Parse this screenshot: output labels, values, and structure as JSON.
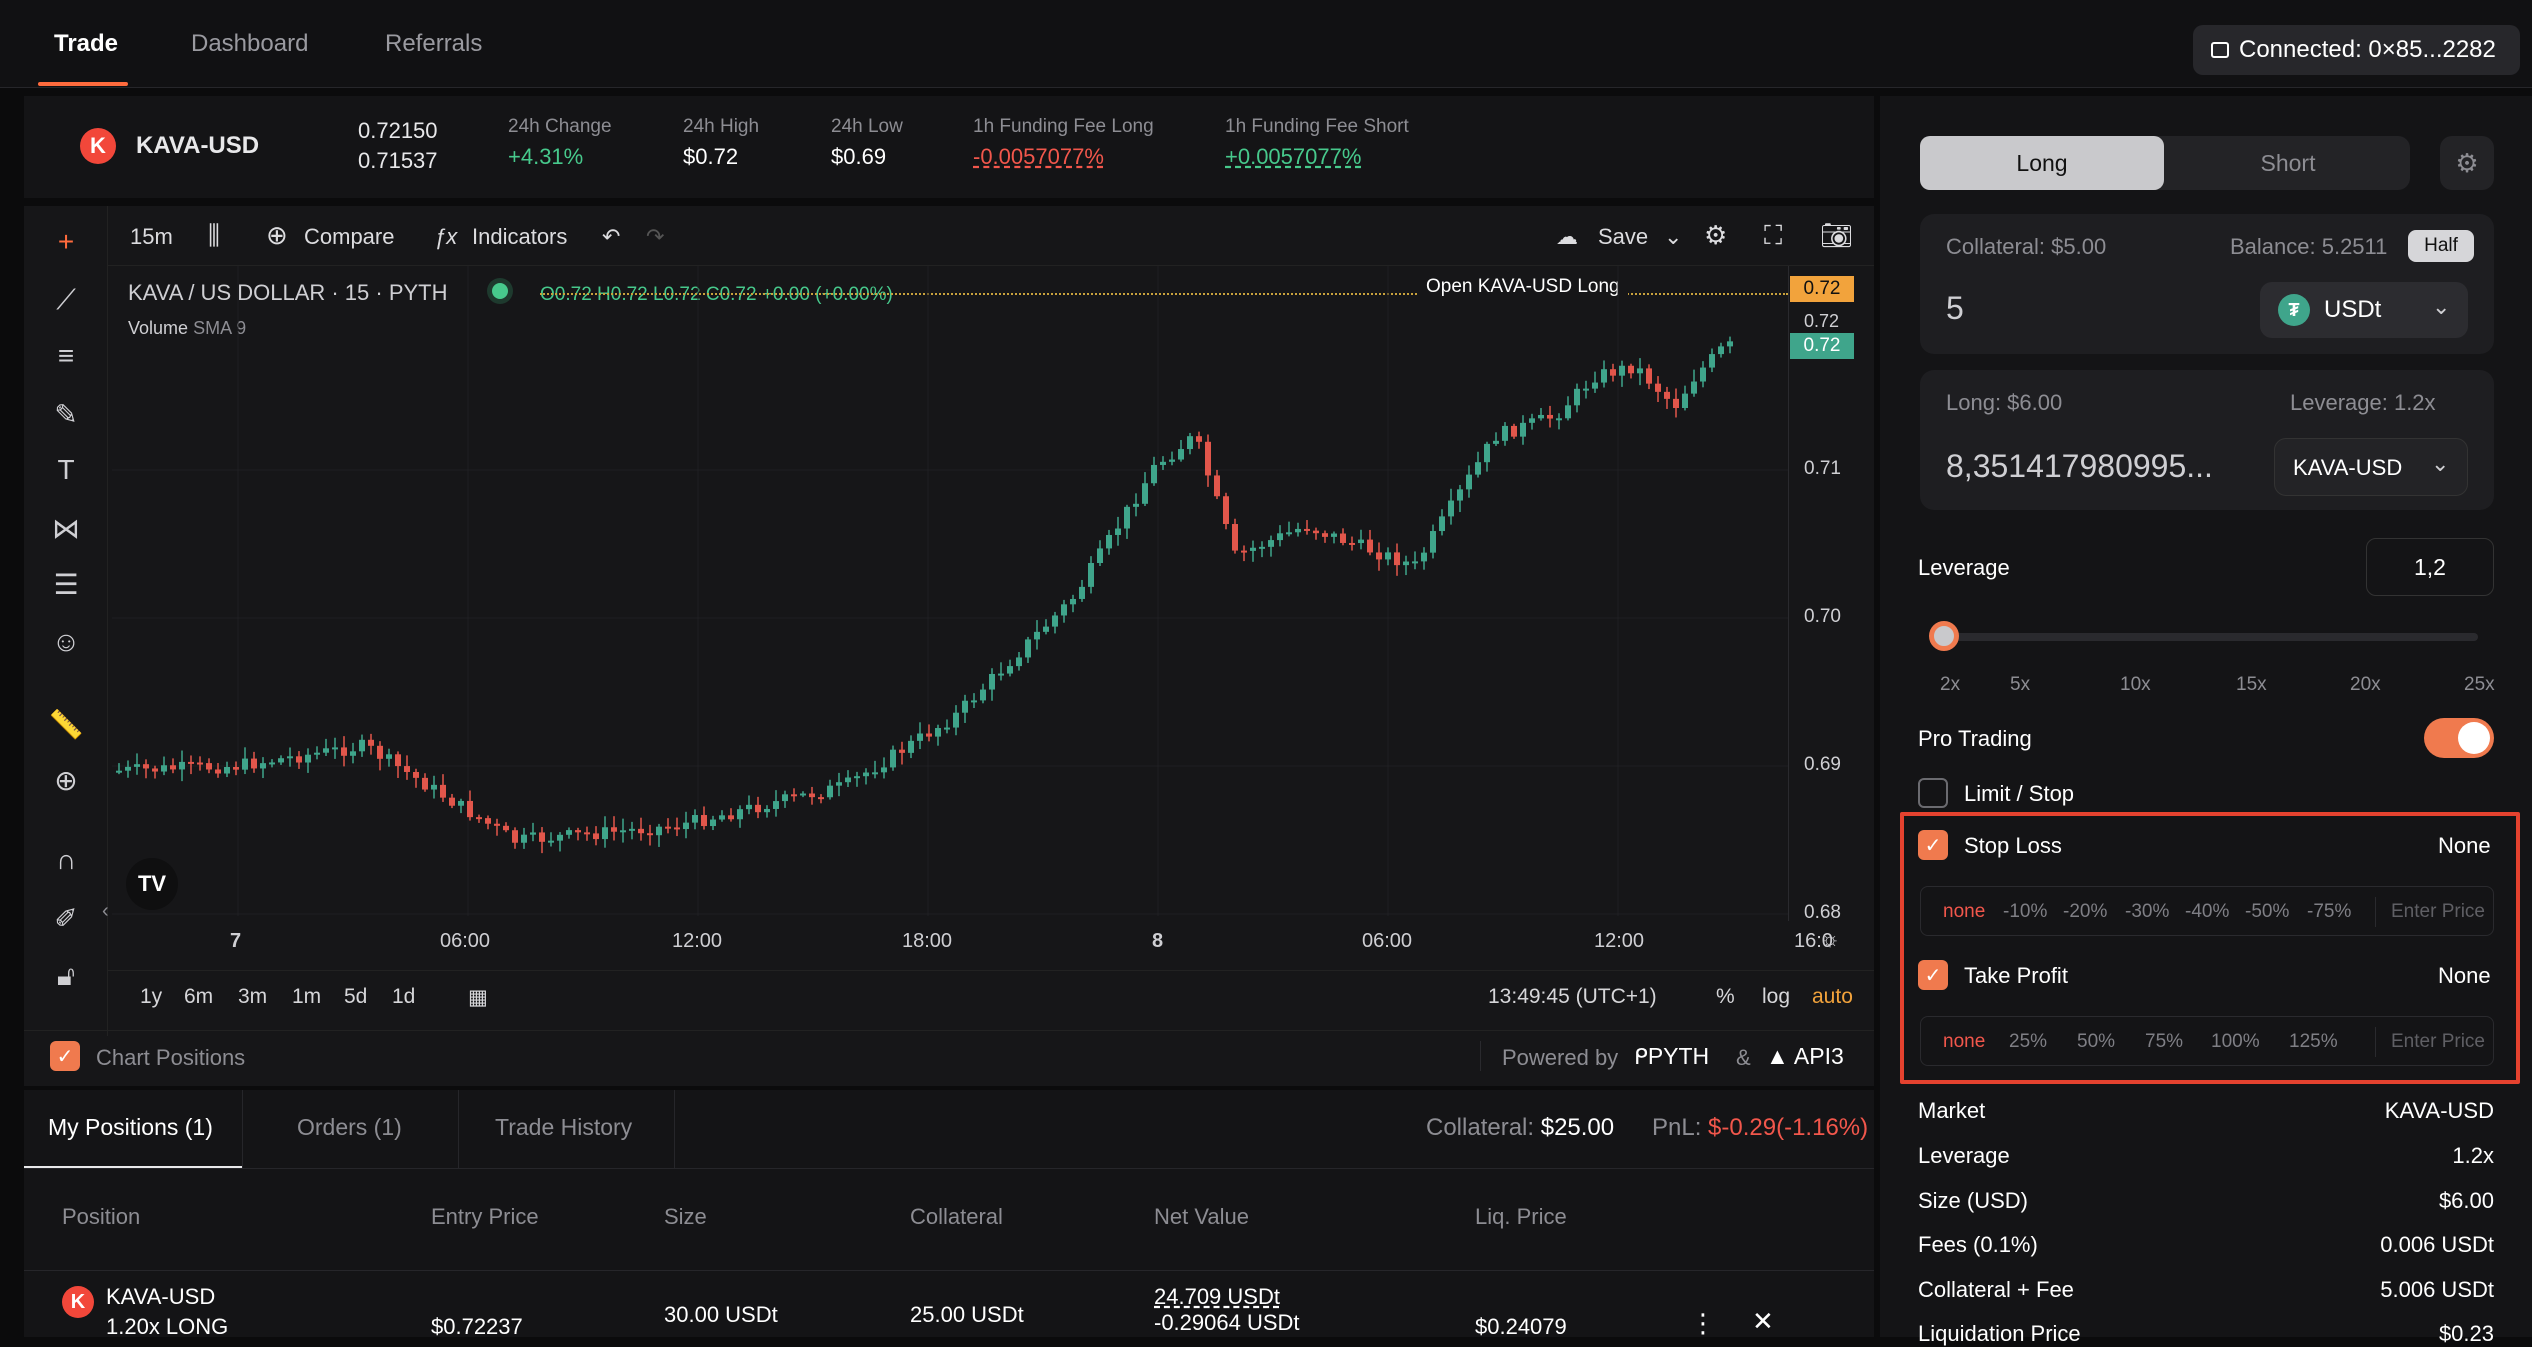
{
  "nav": {
    "tabs": [
      "Trade",
      "Dashboard",
      "Referrals"
    ],
    "wallet": "Connected: 0×85...2282"
  },
  "ticker": {
    "pair": "KAVA-USD",
    "price_top": "0.72150",
    "price_bottom": "0.71537",
    "stats": [
      {
        "label": "24h Change",
        "value": "+4.31%"
      },
      {
        "label": "24h High",
        "value": "$0.72"
      },
      {
        "label": "24h Low",
        "value": "$0.69"
      },
      {
        "label": "1h Funding Fee Long",
        "value": "-0.0057077%"
      },
      {
        "label": "1h Funding Fee Short",
        "value": "+0.0057077%"
      }
    ]
  },
  "chart": {
    "interval": "15m",
    "compare": "Compare",
    "indicators": "Indicators",
    "save": "Save",
    "symbol": "KAVA / US DOLLAR · 15 · PYTH",
    "ohlc": "O0.72 H0.72 L0.72 C0.72 +0.00 (+0.00%)",
    "volume": "Volume",
    "volume_sma": "SMA 9",
    "order_line": "Open KAVA-USD Long",
    "price_tags": [
      "0.72",
      "0.72",
      "0.72"
    ],
    "yticks": [
      "0.71",
      "0.70",
      "0.69",
      "0.68"
    ],
    "xticks": [
      "7",
      "06:00",
      "12:00",
      "18:00",
      "8",
      "06:00",
      "12:00",
      "16:0"
    ],
    "ranges": [
      "1y",
      "6m",
      "3m",
      "1m",
      "5d",
      "1d"
    ],
    "clock": "13:49:45 (UTC+1)",
    "pct": "%",
    "log": "log",
    "auto": "auto",
    "chart_positions": "Chart Positions",
    "powered": "Powered by",
    "pyth": "PYTH",
    "amp": "&",
    "api3": "API3"
  },
  "positions": {
    "tabs": [
      "My Positions (1)",
      "Orders (1)",
      "Trade History"
    ],
    "collateral_label": "Collateral:",
    "collateral": "$25.00",
    "pnl_label": "PnL:",
    "pnl": "$-0.29(-1.16%)",
    "headers": [
      "Position",
      "Entry Price",
      "Size",
      "Collateral",
      "Net Value",
      "Liq. Price"
    ],
    "row": {
      "market": "KAVA-USD",
      "side": "1.20x LONG",
      "entry": "$0.72237",
      "size": "30.00 USDt",
      "collateral": "25.00 USDt",
      "net": "24.709 USDt",
      "net_change": "-0.29064 USDt",
      "liq": "$0.24079"
    }
  },
  "side": {
    "long": "Long",
    "short": "Short",
    "collateral_label": "Collateral: $5.00",
    "balance": "Balance: 5.2511",
    "half": "Half",
    "amount": "5",
    "token": "USDt",
    "long_label": "Long: $6.00",
    "leverage_label": "Leverage: 1.2x",
    "long_amount": "8,351417980995...",
    "market_select": "KAVA-USD",
    "leverage_title": "Leverage",
    "leverage_value": "1,2",
    "leverage_marks": [
      "2x",
      "5x",
      "10x",
      "15x",
      "20x",
      "25x"
    ],
    "leverage_level": 0.01,
    "pro_trading": "Pro Trading",
    "limit_stop": "Limit / Stop",
    "stop_loss": "Stop Loss",
    "stop_loss_value": "None",
    "sl_options": [
      "none",
      "-10%",
      "-20%",
      "-30%",
      "-40%",
      "-50%",
      "-75%"
    ],
    "enter_price": "Enter Price",
    "take_profit": "Take Profit",
    "take_profit_value": "None",
    "tp_options": [
      "none",
      "25%",
      "50%",
      "75%",
      "100%",
      "125%"
    ],
    "summary": [
      {
        "k": "Market",
        "v": "KAVA-USD"
      },
      {
        "k": "Leverage",
        "v": "1.2x"
      },
      {
        "k": "Size (USD)",
        "v": "$6.00"
      },
      {
        "k": "Fees (0.1%)",
        "v": "0.006 USDt"
      },
      {
        "k": "Collateral + Fee",
        "v": "5.006 USDt"
      },
      {
        "k": "Liquidation Price",
        "v": "$0.23"
      }
    ]
  },
  "colors": {
    "accent": "#ff6b3d",
    "up": "#47c98c",
    "down": "#f2574c",
    "highlight": "#e5422f"
  }
}
